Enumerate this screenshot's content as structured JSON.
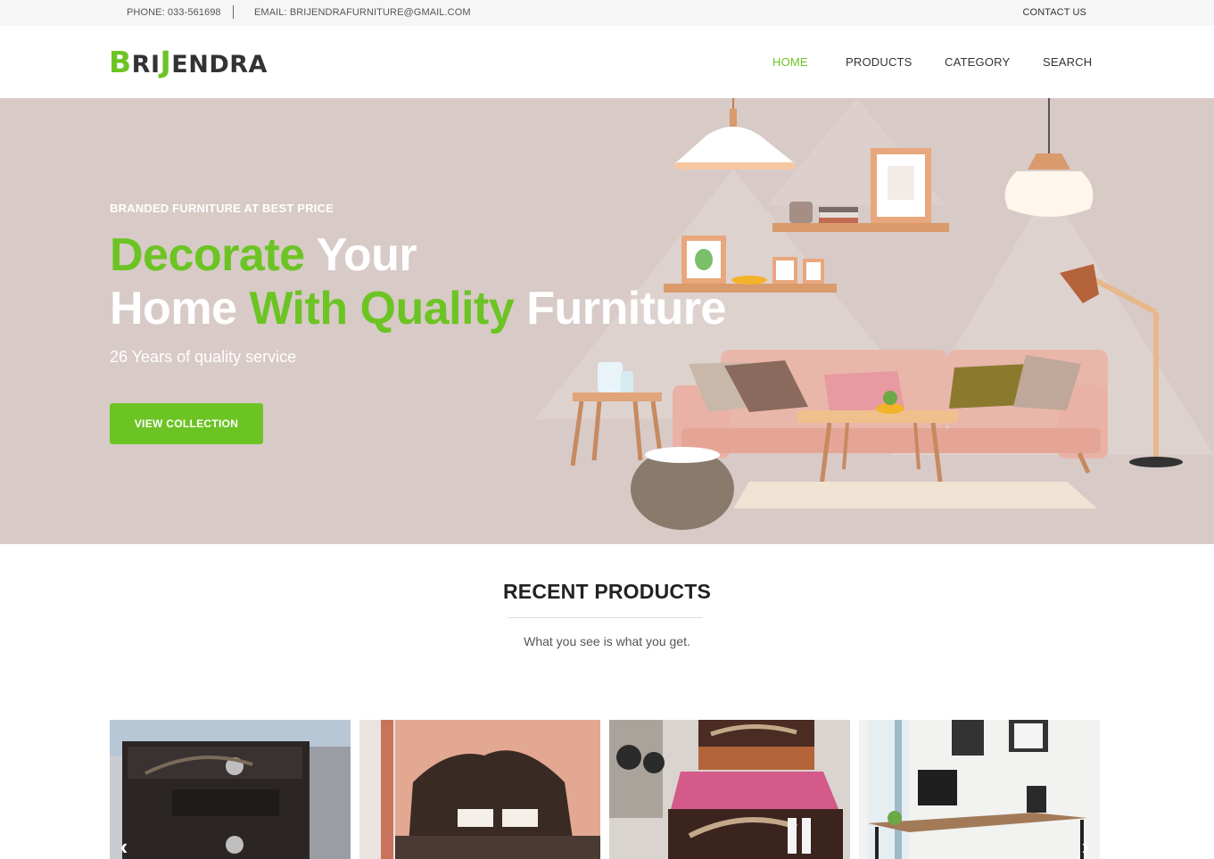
{
  "topbar": {
    "phone": "PHONE: 033-561698",
    "email": "EMAIL: BRIJENDRAFURNITURE@GMAIL.COM",
    "contact": "CONTACT US"
  },
  "brand": {
    "logo_text": "BRIJENDRA"
  },
  "nav": {
    "items": [
      {
        "label": "HOME",
        "active": true
      },
      {
        "label": "PRODUCTS",
        "active": false
      },
      {
        "label": "CATEGORY",
        "active": false
      },
      {
        "label": "SEARCH",
        "active": false
      }
    ]
  },
  "hero": {
    "eyebrow": "BRANDED FURNITURE AT BEST PRICE",
    "headline_1_green": "Decorate",
    "headline_1_white": "Your",
    "headline_2_white_a": "Home",
    "headline_2_green": "With Quality",
    "headline_2_white_b": "Furniture",
    "subtitle": "26 Years of quality service",
    "cta": "VIEW COLLECTION"
  },
  "recent": {
    "title": "RECENT PRODUCTS",
    "subtitle": "What you see is what you get."
  },
  "products": [
    {
      "icon": "wooden-bed-panels-photo"
    },
    {
      "icon": "carved-headboard-photo"
    },
    {
      "icon": "double-bed-photo"
    },
    {
      "icon": "office-desk-photo"
    }
  ],
  "carousel": {
    "prev_icon": "chevron-left-icon",
    "next_icon": "chevron-right-icon"
  },
  "colors": {
    "accent": "#6cc424",
    "hero_bg": "#d8cac7",
    "topbar_bg": "#f6f6f6"
  }
}
